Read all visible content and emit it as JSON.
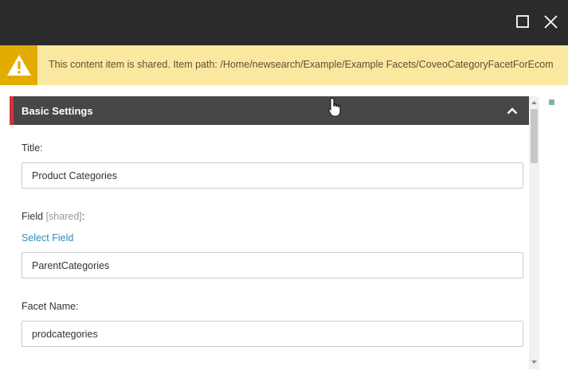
{
  "titlebar": {
    "maximize_icon": "maximize-icon",
    "close_icon": "close-icon"
  },
  "warning": {
    "icon": "warning-icon",
    "message": "This content item is shared. Item path: /Home/newsearch/Example/Example Facets/CoveoCategoryFacetForEcom"
  },
  "section": {
    "title": "Basic Settings",
    "collapse_icon": "chevron-up-icon"
  },
  "fields": {
    "title_label": "Title:",
    "title_value": "Product Categories",
    "field_label": "Field",
    "field_shared_tag": "[shared]",
    "field_label_suffix": ":",
    "select_field_link": "Select Field",
    "field_value": "ParentCategories",
    "facet_name_label": "Facet Name:",
    "facet_name_value": "prodcategories"
  },
  "colors": {
    "titlebar": "#2b2b2b",
    "warning_bg": "#fbe8a0",
    "warning_icon_bg": "#e3ac00",
    "section_header": "#474747",
    "section_accent": "#d0343a",
    "link": "#2f8bb8"
  }
}
